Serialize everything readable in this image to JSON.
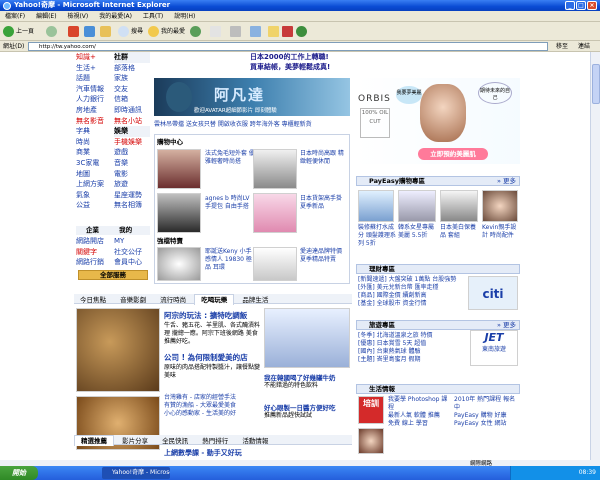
{
  "window": {
    "title": "Yahoo!奇摩 - Microsoft Internet Explorer"
  },
  "menu": [
    "檔案(F)",
    "編輯(E)",
    "檢視(V)",
    "我的最愛(A)",
    "工具(T)",
    "說明(H)"
  ],
  "toolbar": {
    "back": "上一頁",
    "search": "搜尋",
    "favorites": "我的最愛"
  },
  "address": {
    "label": "網址(D)",
    "value": "http://tw.yahoo.com/",
    "go": "移至",
    "links": "連結"
  },
  "left_nav": {
    "col1": [
      "知識+",
      "生活+",
      "話題",
      "汽車情報",
      "人力銀行",
      "房地產",
      "無名影音",
      "字典",
      "時尚",
      "商業",
      "3C家電",
      "地圖",
      "上網方案",
      "氣象",
      "公益"
    ],
    "col2": [
      "拍賣",
      "部落格",
      "家族",
      "交友",
      "信箱",
      "即時通訊",
      "無名小站",
      "購物中心",
      "手機娛樂",
      "遊戲",
      "音樂",
      "電影",
      "旅遊",
      "星座運勢",
      "無名相簿"
    ],
    "section_labels": [
      "社群",
      "娛樂",
      "企業",
      "我的"
    ],
    "col1b": [
      "網路開店",
      "關鍵字",
      "網路行銷"
    ],
    "col2b": [
      "MY",
      "社交公仔",
      "會員中心"
    ],
    "all_services": "全部服務"
  },
  "top_news": [
    "日本2000的工作上轉職!",
    "買車結帳，美夢輕鬆成真!"
  ],
  "banner": {
    "text": "阿凡達",
    "sub": "歡迎AVATAR超細節影片 即刻體驗"
  },
  "hot_links": "雲林吊帶擋 送女孩只替 開啟收衣服 跨年海外客 專櫃輕新貨",
  "shopping": {
    "title": "購物中心",
    "items": [
      "法式兔毛短外套 優雅輕奢時尚搭",
      "日本時尚高跟 精緻輕便休閒",
      "agnes b 時尚LV 手提包 自由手搭",
      "日本貨架高手掛 夏季新品",
      "專屬自己設計 優雅女包"
    ],
    "feature_title": "強檔特賣",
    "features": [
      "耶誕送Keny 小手感情人 19830 極品 耳環",
      "愛迪達品牌特價 夏季精品特賣"
    ]
  },
  "tabs1": [
    "今日焦點",
    "音樂影劇",
    "流行時尚",
    "吃喝玩樂",
    "品牌生活"
  ],
  "tabs1_active": 3,
  "food": {
    "headline": "阿宗的玩法 : 擴特吃調飯",
    "snippet": "牛舌、豬五花、羊里肌、各式醃漬料理 攏總一應。阿宗下班後網路 美食推薦好吃。",
    "headline2": "公司 ! 為何限制愛美的店",
    "snippet2": "原味的肉品搭配特製醬汁，讓餐點變美味",
    "links": [
      "台灣雞有 - 店家的經營手法",
      "有贊的漁船 - 大眾最愛美食",
      "小心的感動家 - 生活美的好"
    ]
  },
  "food_right": {
    "headline": "我在韓國喝了好幾罐牛奶",
    "snippet": "不能錯過的特色飲料",
    "headline2": "好心眼製一日醬方便好吃",
    "snippet2": "推薦新品趕快試試"
  },
  "tabs2": [
    "精選推薦",
    "影片分享",
    "全民快訊",
    "熱門排行",
    "活動情報"
  ],
  "bottom_news": "上網數學課 - 動手又好玩",
  "ad": {
    "brand": "ORBIS",
    "badge": "100% OIL CUT",
    "cta": "立即預約美麗肌",
    "bubble1": "我要夢美麗",
    "bubble2": "期待未來的自己"
  },
  "payeasy": {
    "title": "PayEasy購物專區",
    "more": "» 更多",
    "items": [
      "裝修蘇打水成分 頭髮護理系列 5折",
      "韓系女星專屬美麗 5.5折",
      "日本美白保養品 套組",
      "Kevin親手設計 時尚配件"
    ]
  },
  "finance": {
    "title": "理財專區",
    "lines": [
      "[新聞速遞] 大盤突破 1萬點 台股強勢",
      "[外匯] 美元兌新台幣 匯率走穩",
      "[商品] 國際金價 續創新高",
      "[基金] 全球股市 資金行情"
    ],
    "logo": "citi"
  },
  "travel": {
    "title": "旅遊專區",
    "more": "» 更多",
    "lines": [
      "[冬季] 北海道溫泉之旅 特價",
      "[優惠] 日本賞雪 5天 超值",
      "[國內] 台東熱氣球 體驗",
      "[主題] 峇里島蜜月 假期"
    ],
    "logo": "JET",
    "logo_sub": "東南旅遊"
  },
  "life": {
    "title": "生活情報",
    "lines": [
      "我要學 Photoshop 課程",
      "2010年 熱門課程 報名中",
      "最新人氣 軟體 推薦",
      "PayEasy 購物 好康",
      "免費 線上 學習",
      "PayEasy 女性 網站"
    ]
  },
  "status": {
    "zone": "網際網路"
  },
  "taskbar": {
    "start": "開始",
    "window": "Yahoo!奇摩 - Microso...",
    "clock": "08:39"
  }
}
